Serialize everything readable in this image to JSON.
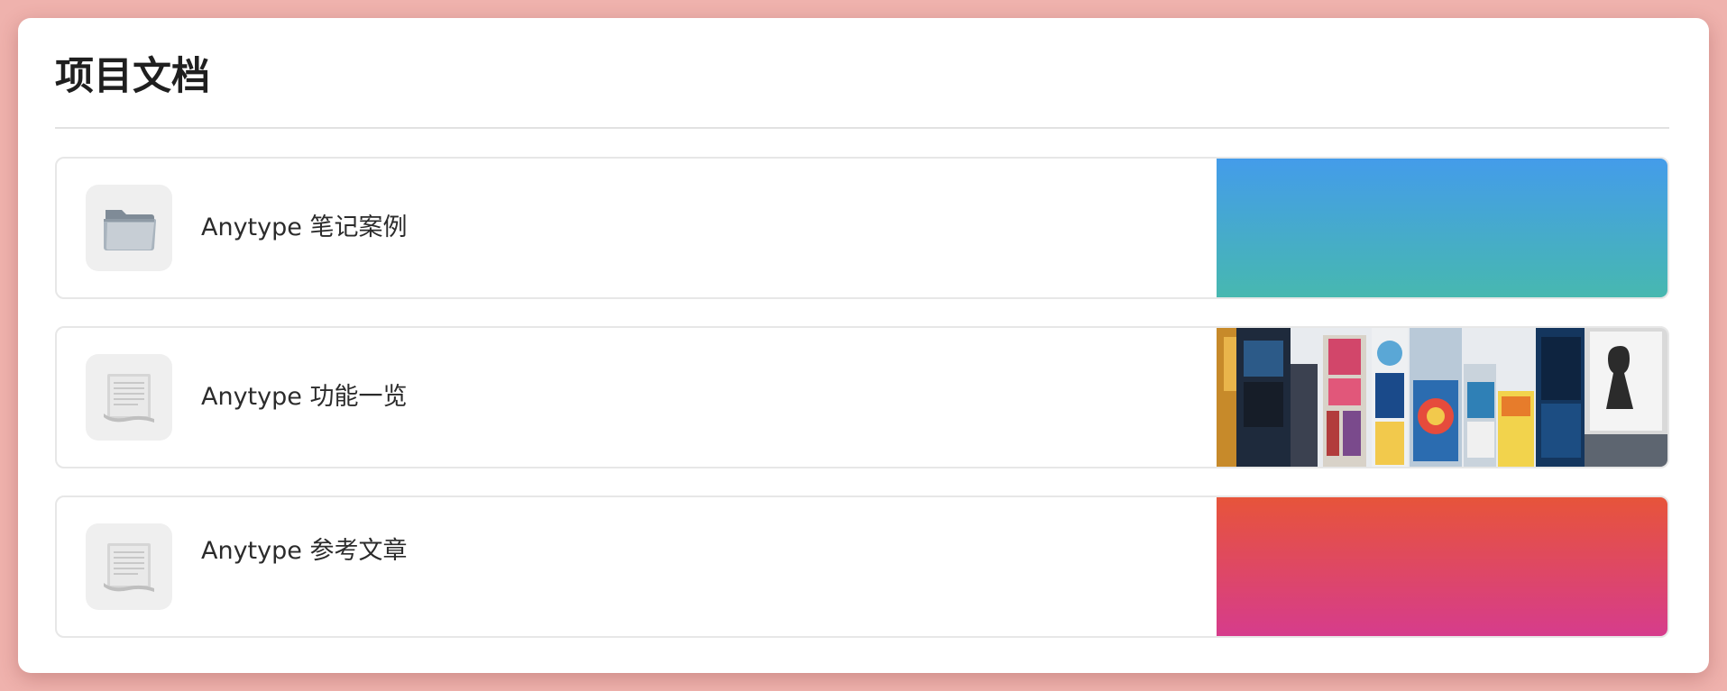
{
  "page": {
    "title": "项目文档"
  },
  "cards": [
    {
      "label": "Anytype 笔记案例",
      "icon": "folder-icon",
      "cover": "blue-teal-gradient",
      "cover_colors": [
        "#449cea",
        "#47b8b0"
      ]
    },
    {
      "label": "Anytype 功能一览",
      "icon": "document-scroll-icon",
      "cover": "city-billboards-photo"
    },
    {
      "label": "Anytype 参考文章",
      "icon": "document-scroll-icon",
      "cover": "red-pink-gradient",
      "cover_colors": [
        "#e7543a",
        "#d63c8c"
      ]
    }
  ],
  "colors": {
    "background": "#efb2ad",
    "panel": "#ffffff",
    "text": "#1f1f1f"
  }
}
